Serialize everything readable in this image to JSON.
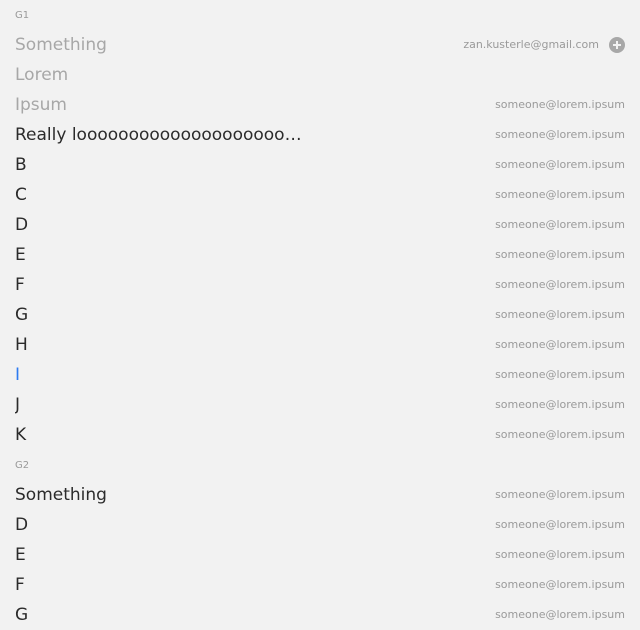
{
  "groups": [
    {
      "label": "G1",
      "items": [
        {
          "label": "Something",
          "email": "zan.kusterle@gmail.com",
          "icon": "add-circle-icon"
        },
        {
          "label": "Lorem",
          "email": ""
        },
        {
          "label": "Ipsum",
          "email": "someone@lorem.ipsum"
        },
        {
          "label": "Really looooooooooooooooooooooooooooooooong",
          "email": "someone@lorem.ipsum"
        },
        {
          "label": "B",
          "email": "someone@lorem.ipsum"
        },
        {
          "label": "C",
          "email": "someone@lorem.ipsum"
        },
        {
          "label": "D",
          "email": "someone@lorem.ipsum"
        },
        {
          "label": "E",
          "email": "someone@lorem.ipsum"
        },
        {
          "label": "F",
          "email": "someone@lorem.ipsum"
        },
        {
          "label": "G",
          "email": "someone@lorem.ipsum"
        },
        {
          "label": "H",
          "email": "someone@lorem.ipsum"
        },
        {
          "label": "I",
          "email": "someone@lorem.ipsum"
        },
        {
          "label": "J",
          "email": "someone@lorem.ipsum"
        },
        {
          "label": "K",
          "email": "someone@lorem.ipsum"
        }
      ]
    },
    {
      "label": "G2",
      "items": [
        {
          "label": "Something",
          "email": "someone@lorem.ipsum"
        },
        {
          "label": "D",
          "email": "someone@lorem.ipsum"
        },
        {
          "label": "E",
          "email": "someone@lorem.ipsum"
        },
        {
          "label": "F",
          "email": "someone@lorem.ipsum"
        },
        {
          "label": "G",
          "email": "someone@lorem.ipsum"
        }
      ]
    }
  ],
  "colors": {
    "selected_text": "#2e7bf0",
    "disabled_text": "#a7a7a7",
    "secondary_text": "#9a9a9a",
    "background": "#f2f2f2"
  }
}
